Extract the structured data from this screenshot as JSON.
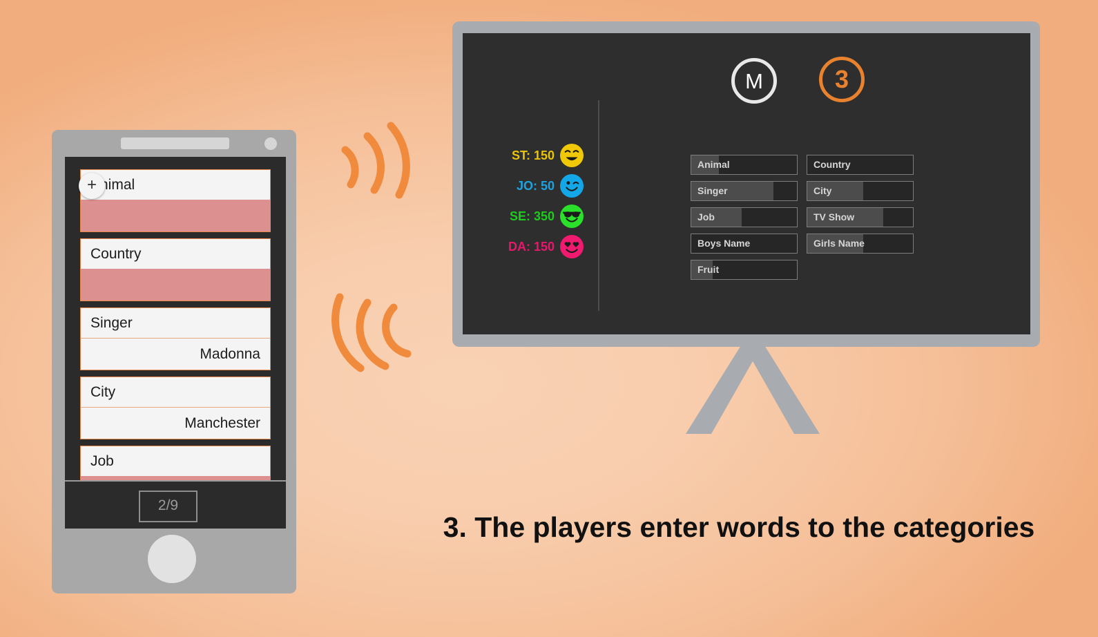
{
  "background": {
    "center_color": "#f8cdad",
    "edge_color": "#f1ad7d"
  },
  "phone": {
    "add_button_label": "+",
    "page_counter": "2/9",
    "categories": [
      {
        "label": "Animal",
        "value": "",
        "filled": false
      },
      {
        "label": "Country",
        "value": "",
        "filled": false
      },
      {
        "label": "Singer",
        "value": "Madonna",
        "filled": true
      },
      {
        "label": "City",
        "value": "Manchester",
        "filled": true
      },
      {
        "label": "Job",
        "value": "",
        "filled": false
      }
    ]
  },
  "tv": {
    "letter_badge": "M",
    "round_badge": "3",
    "letter_badge_color": "#e8e8e8",
    "round_badge_color": "#e8822e",
    "players": [
      {
        "initials": "ST",
        "score": "150",
        "label": "ST: 150",
        "color": "#e8c30d",
        "face": "grinning-face",
        "avatar_color": "#f0c808"
      },
      {
        "initials": "JO",
        "score": "50",
        "label": "JO: 50",
        "color": "#1fa3e0",
        "face": "winking-face",
        "avatar_color": "#14a7e8"
      },
      {
        "initials": "SE",
        "score": "350",
        "label": "SE: 350",
        "color": "#1ecb1e",
        "face": "sunglasses-face",
        "avatar_color": "#2ae02a"
      },
      {
        "initials": "DA",
        "score": "150",
        "label": "DA: 150",
        "color": "#e8176b",
        "face": "heart-eyes-face",
        "avatar_color": "#f01a6e"
      }
    ],
    "fields": [
      {
        "label": "Animal",
        "fill_percent": 26
      },
      {
        "label": "Country",
        "fill_percent": 0
      },
      {
        "label": "Singer",
        "fill_percent": 78
      },
      {
        "label": "City",
        "fill_percent": 53
      },
      {
        "label": "Job",
        "fill_percent": 48
      },
      {
        "label": "TV Show",
        "fill_percent": 72
      },
      {
        "label": "Boys Name",
        "fill_percent": 0
      },
      {
        "label": "Girls Name",
        "fill_percent": 53
      },
      {
        "label": "Fruit",
        "fill_percent": 20
      }
    ]
  },
  "caption": {
    "text": "3. The players enter words to the categories"
  }
}
